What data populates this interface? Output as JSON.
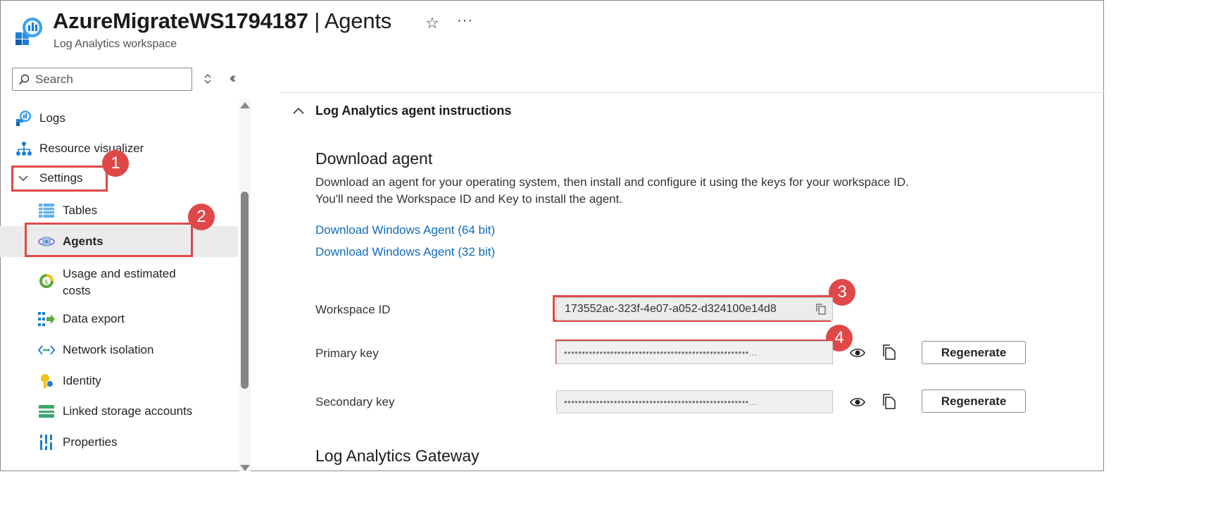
{
  "header": {
    "title_bold": "AzureMigrateWS1794187",
    "title_rest": "| Agents",
    "subtitle": "Log Analytics workspace",
    "favorite_icon": "star-icon",
    "more_icon": "ellipsis-icon",
    "more_text": "···"
  },
  "search": {
    "placeholder": "Search"
  },
  "sidebar": {
    "items": [
      {
        "label": "Logs",
        "icon": "logs-icon"
      },
      {
        "label": "Resource visualizer",
        "icon": "resource-visualizer-icon"
      },
      {
        "label": "Settings",
        "icon": "chevron-down-icon"
      },
      {
        "label": "Tables",
        "icon": "tables-icon"
      },
      {
        "label": "Agents",
        "icon": "agents-icon",
        "selected": true
      },
      {
        "label": "Usage and estimated",
        "label2": "costs",
        "icon": "usage-costs-icon"
      },
      {
        "label": "Data export",
        "icon": "data-export-icon"
      },
      {
        "label": "Network isolation",
        "icon": "network-isolation-icon"
      },
      {
        "label": "Identity",
        "icon": "identity-icon"
      },
      {
        "label": "Linked storage accounts",
        "icon": "linked-storage-icon"
      },
      {
        "label": "Properties",
        "icon": "properties-icon"
      }
    ]
  },
  "callouts": [
    "1",
    "2",
    "3",
    "4"
  ],
  "main": {
    "section_title": "Log Analytics agent instructions",
    "download_heading": "Download agent",
    "desc_line1": "Download an agent for your operating system, then install and configure it using the keys for your workspace ID.",
    "desc_line2": "You'll need the Workspace ID and Key to install the agent.",
    "link_64": "Download Windows Agent (64 bit)",
    "link_32": "Download Windows Agent (32 bit)",
    "workspace_id_label": "Workspace ID",
    "workspace_id_value": "173552ac-323f-4e07-a052-d324100e14d8",
    "primary_key_label": "Primary key",
    "primary_key_value": "••••••••••••••••••••••••••••••••••••••••••••••••••••...",
    "secondary_key_label": "Secondary key",
    "secondary_key_value": "••••••••••••••••••••••••••••••••••••••••••••••••••••...",
    "regenerate_label": "Regenerate",
    "gateway_heading": "Log Analytics Gateway"
  },
  "colors": {
    "accent_link": "#0f6cbd",
    "callout_red": "#e04848",
    "selected_bg": "#ebebeb"
  }
}
